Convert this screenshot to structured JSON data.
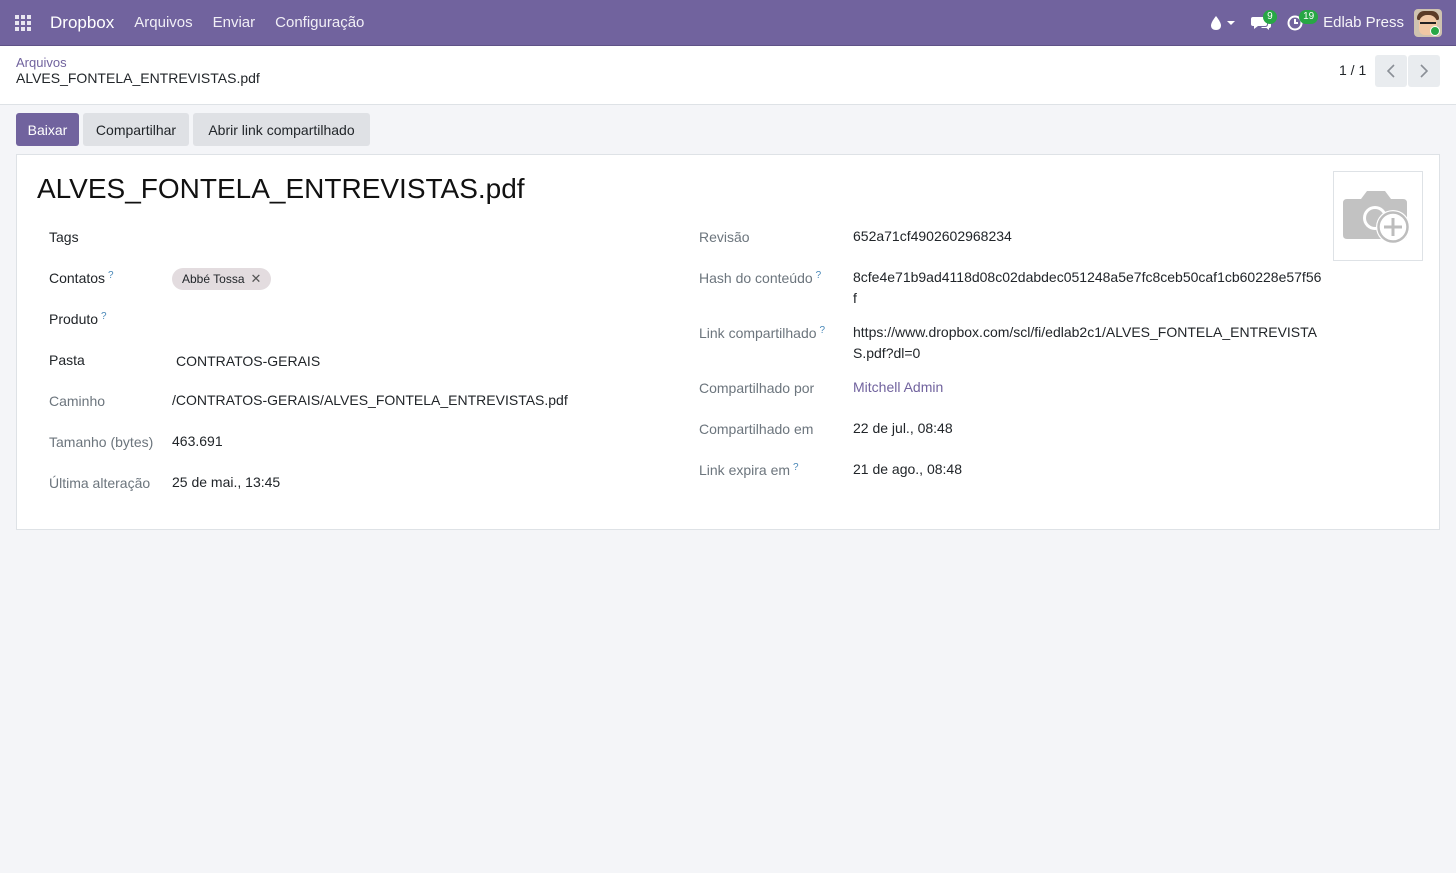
{
  "navbar": {
    "brand": "Dropbox",
    "menu": [
      "Arquivos",
      "Enviar",
      "Configuração"
    ],
    "messages_count": "9",
    "activities_count": "19",
    "company": "Edlab Press",
    "accent": "#71639e"
  },
  "breadcrumb": {
    "parent": "Arquivos",
    "current": "ALVES_FONTELA_ENTREVISTAS.pdf"
  },
  "pager": {
    "value": "1 / 1"
  },
  "actions": {
    "download": "Baixar",
    "share": "Compartilhar",
    "open_link": "Abrir link compartilhado"
  },
  "record": {
    "title": "ALVES_FONTELA_ENTREVISTAS.pdf",
    "left": {
      "tags_label": "Tags",
      "contacts_label": "Contatos",
      "contact_tag": "Abbé Tossa",
      "product_label": "Produto",
      "folder_label": "Pasta",
      "folder_value": "CONTRATOS-GERAIS",
      "path_label": "Caminho",
      "path_value": "/CONTRATOS-GERAIS/ALVES_FONTELA_ENTREVISTAS.pdf",
      "size_label": "Tamanho (bytes)",
      "size_value": "463.691",
      "modified_label": "Última alteração",
      "modified_value": "25 de mai., 13:45"
    },
    "right": {
      "revision_label": "Revisão",
      "revision_value": "652a71cf4902602968234",
      "hash_label": "Hash do conteúdo",
      "hash_value": "8cfe4e71b9ad4118d08c02dabdec051248a5e7fc8ceb50caf1cb60228e57f56f",
      "link_label": "Link compartilhado",
      "link_value": "https://www.dropbox.com/scl/fi/edlab2c1/ALVES_FONTELA_ENTREVISTAS.pdf?dl=0",
      "shared_by_label": "Compartilhado por",
      "shared_by_value": "Mitchell Admin",
      "shared_at_label": "Compartilhado em",
      "shared_at_value": "22 de jul., 08:48",
      "expires_label": "Link expira em",
      "expires_value": "21 de ago., 08:48"
    },
    "help_mark": "?"
  }
}
